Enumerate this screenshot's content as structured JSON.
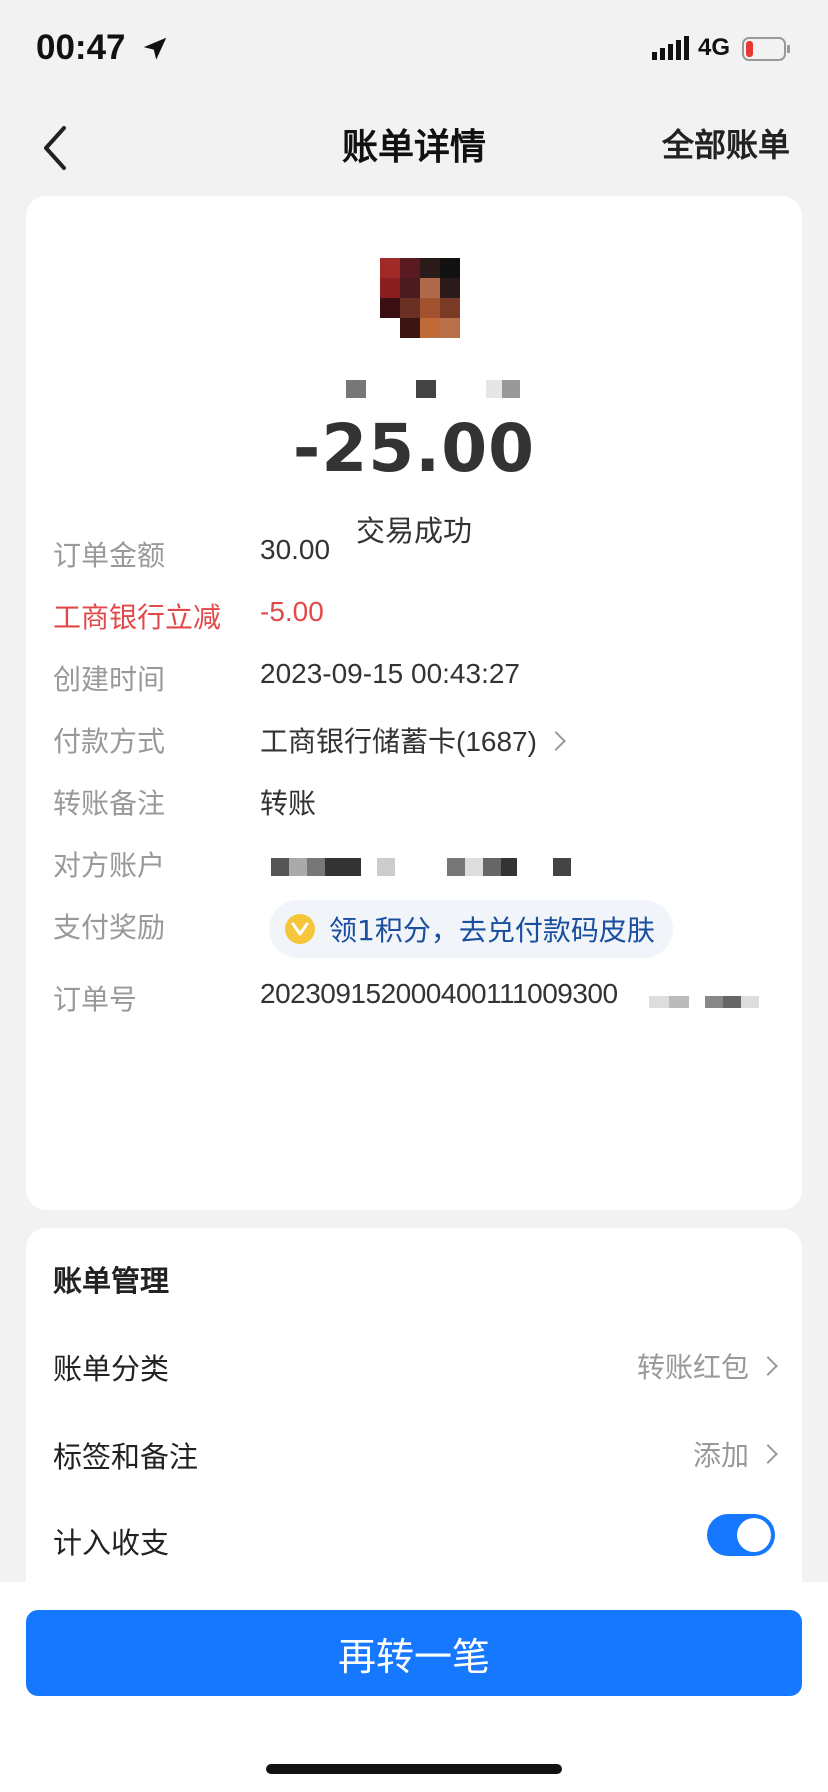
{
  "status_bar": {
    "time": "00:47",
    "network": "4G",
    "location_icon": "location-arrow-icon",
    "battery_color": "#e53935"
  },
  "nav": {
    "title": "账单详情",
    "right_link": "全部账单"
  },
  "summary": {
    "amount": "-25.00",
    "status": "交易成功"
  },
  "details": [
    {
      "label": "订单金额",
      "value": "30.00"
    },
    {
      "label": "工商银行立减",
      "value": "-5.00",
      "color": "#e14a4a"
    },
    {
      "label": "创建时间",
      "value": "2023-09-15 00:43:27"
    },
    {
      "label": "付款方式",
      "value": "工商银行储蓄卡(1687)"
    },
    {
      "label": "转账备注",
      "value": "转账"
    },
    {
      "label": "对方账户",
      "value": ""
    },
    {
      "label": "支付奖励",
      "value": "领1积分，去兑付款码皮肤"
    },
    {
      "label": "订单号",
      "value": "202309152000400111009300"
    }
  ],
  "management": {
    "title": "账单管理",
    "category_label": "账单分类",
    "category_value": "转账红包",
    "tags_label": "标签和备注",
    "tags_value": "添加",
    "include_label": "计入收支",
    "include_on": true
  },
  "button": {
    "label": "再转一笔"
  },
  "colors": {
    "accent": "#1677ff",
    "discount": "#e14a4a",
    "reward_text": "#1a4ea0"
  }
}
